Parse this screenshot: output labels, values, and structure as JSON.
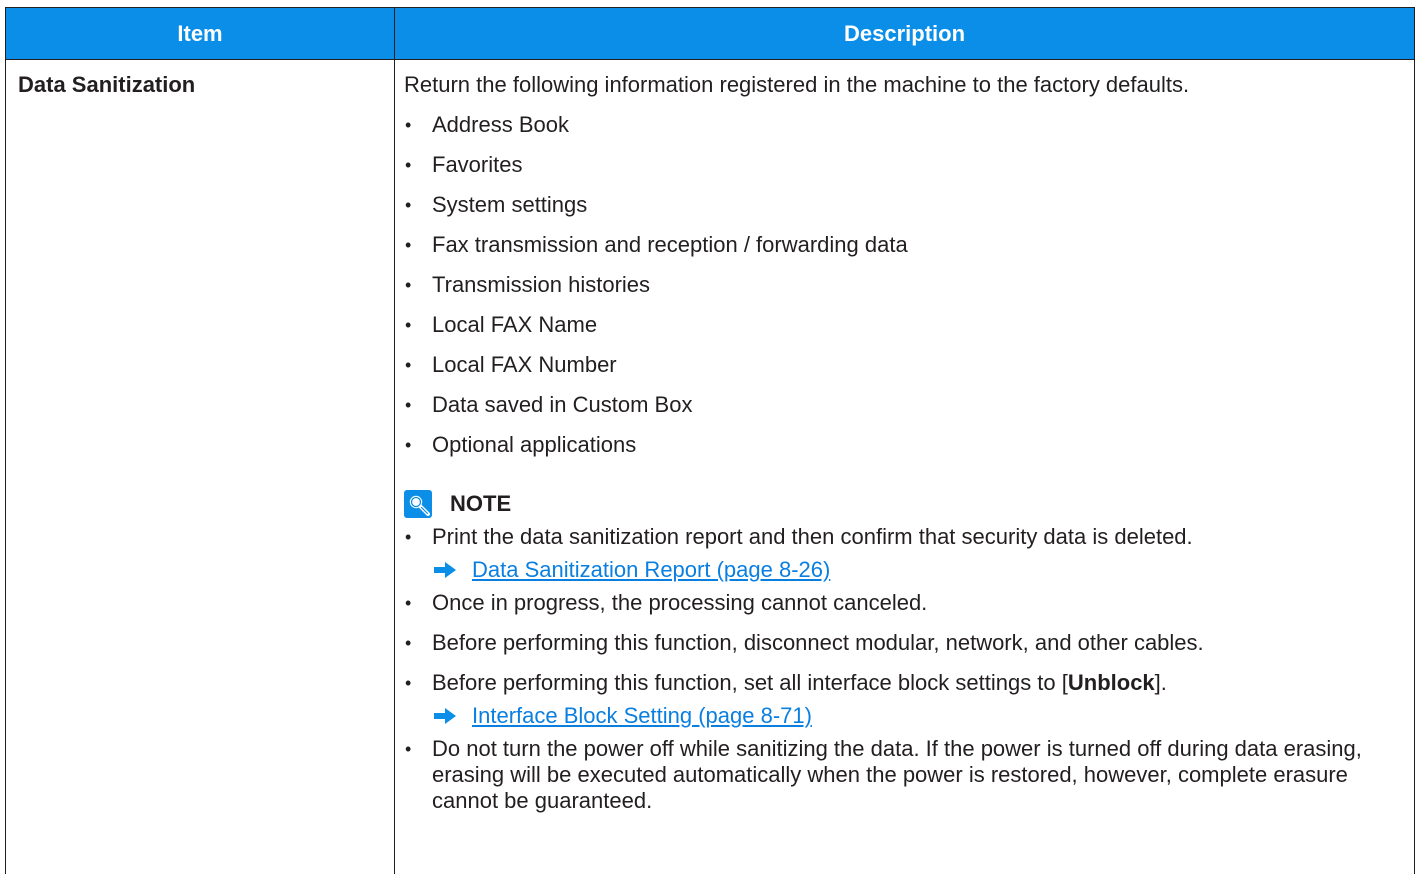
{
  "table": {
    "header_item": "Item",
    "header_description": "Description",
    "header_color": "#0a8ee8"
  },
  "row": {
    "item": "Data Sanitization",
    "intro": "Return the following information registered in the machine to the factory defaults.",
    "bullets": [
      "Address Book",
      "Favorites",
      "System settings",
      "Fax transmission and reception / forwarding data",
      "Transmission histories",
      "Local FAX Name",
      "Local FAX Number",
      "Data saved in Custom Box",
      "Optional applications"
    ],
    "note": {
      "icon": "note-magnifier-icon",
      "title": "NOTE",
      "items": [
        "Print the data sanitization report and then confirm that security data is deleted.",
        "Once in progress, the processing cannot canceled.",
        "Before performing this function, disconnect modular, network, and other cables.",
        "Do not turn the power off while sanitizing the data. If the power is turned off during data erasing, erasing will be executed automatically when the power is restored, however, complete erasure cannot be guaranteed."
      ],
      "item4_prefix": "Before performing this function, set all interface block settings to [",
      "item4_bold": "Unblock",
      "item4_suffix": "].",
      "link1": "Data Sanitization Report (page 8-26)",
      "link2": "Interface Block Setting (page 8-71)",
      "link_color": "#0a7fe0"
    }
  }
}
